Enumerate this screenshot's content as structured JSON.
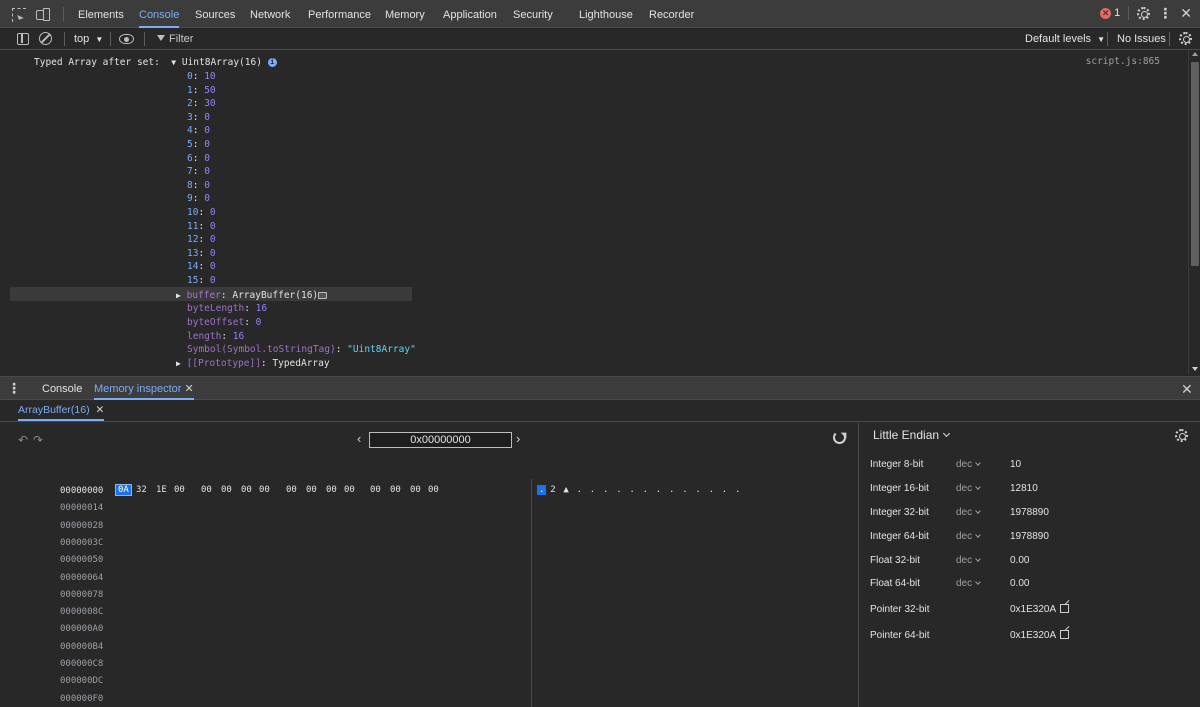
{
  "top_tabs": [
    "Elements",
    "Console",
    "Sources",
    "Network",
    "Performance",
    "Memory",
    "Application",
    "Security",
    "Lighthouse",
    "Recorder"
  ],
  "active_tab": "Console",
  "error_count": "1",
  "toolbar": {
    "context": "top",
    "filter_placeholder": "Filter",
    "levels": "Default levels",
    "issues": "No Issues"
  },
  "console": {
    "log_prefix": "Typed Array after set:",
    "object_label": "Uint8Array(16)",
    "source": "script.js:865",
    "indices": [
      {
        "k": "0",
        "v": "10"
      },
      {
        "k": "1",
        "v": "50"
      },
      {
        "k": "2",
        "v": "30"
      },
      {
        "k": "3",
        "v": "0"
      },
      {
        "k": "4",
        "v": "0"
      },
      {
        "k": "5",
        "v": "0"
      },
      {
        "k": "6",
        "v": "0"
      },
      {
        "k": "7",
        "v": "0"
      },
      {
        "k": "8",
        "v": "0"
      },
      {
        "k": "9",
        "v": "0"
      },
      {
        "k": "10",
        "v": "0"
      },
      {
        "k": "11",
        "v": "0"
      },
      {
        "k": "12",
        "v": "0"
      },
      {
        "k": "13",
        "v": "0"
      },
      {
        "k": "14",
        "v": "0"
      },
      {
        "k": "15",
        "v": "0"
      }
    ],
    "buffer_key": "buffer",
    "buffer_val": "ArrayBuffer(16)",
    "byteLength_key": "byteLength",
    "byteLength_val": "16",
    "byteOffset_key": "byteOffset",
    "byteOffset_val": "0",
    "length_key": "length",
    "length_val": "16",
    "symbol_key": "Symbol(Symbol.toStringTag)",
    "symbol_val": "\"Uint8Array\"",
    "proto_key": "[[Prototype]]",
    "proto_val": "TypedArray"
  },
  "drawer": {
    "tabs": [
      "Console",
      "Memory inspector"
    ],
    "active": "Memory inspector",
    "subtab": "ArrayBuffer(16)"
  },
  "memory": {
    "address": "0x00000000",
    "offsets": [
      "00000000",
      "00000014",
      "00000028",
      "0000003C",
      "00000050",
      "00000064",
      "00000078",
      "0000008C",
      "000000A0",
      "000000B4",
      "000000C8",
      "000000DC",
      "000000F0"
    ],
    "bytes": [
      "0A",
      "32",
      "1E",
      "00",
      "00",
      "00",
      "00",
      "00",
      "00",
      "00",
      "00",
      "00",
      "00",
      "00",
      "00",
      "00"
    ],
    "ascii": [
      ".",
      "2",
      "▲",
      ".",
      ".",
      ".",
      ".",
      ".",
      ".",
      ".",
      ".",
      ".",
      ".",
      ".",
      ".",
      "."
    ],
    "endianness": "Little Endian",
    "values": [
      {
        "label": "Integer 8-bit",
        "mode": "dec",
        "value": "10"
      },
      {
        "label": "Integer 16-bit",
        "mode": "dec",
        "value": "12810"
      },
      {
        "label": "Integer 32-bit",
        "mode": "dec",
        "value": "1978890"
      },
      {
        "label": "Integer 64-bit",
        "mode": "dec",
        "value": "1978890"
      },
      {
        "label": "Float 32-bit",
        "mode": "dec",
        "value": "0.00"
      },
      {
        "label": "Float 64-bit",
        "mode": "dec",
        "value": "0.00"
      },
      {
        "label": "Pointer 32-bit",
        "mode": "",
        "value": "0x1E320A"
      },
      {
        "label": "Pointer 64-bit",
        "mode": "",
        "value": "0x1E320A"
      }
    ]
  }
}
